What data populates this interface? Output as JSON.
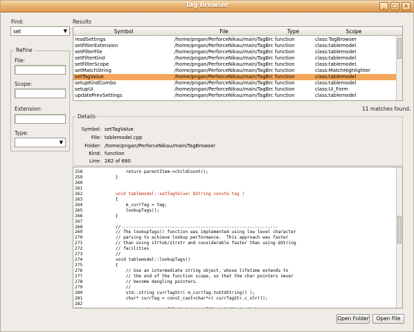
{
  "window": {
    "title": "Tag Browser"
  },
  "left": {
    "find_label": "Find:",
    "find_value": "set",
    "refine_label": "Refine",
    "file_label": "File:",
    "scope_label": "Scope:",
    "extension_label": "Extension:",
    "type_label": "Type:"
  },
  "results": {
    "label": "Results",
    "headers": {
      "symbol": "Symbol",
      "file": "File",
      "type": "Type",
      "scope": "Scope"
    },
    "rows": [
      {
        "symbol": "readSettings",
        "file": "/home/pngan/PerforceNikau/main/TagBrowser",
        "type": "function",
        "scope": "class:TagBrowser"
      },
      {
        "symbol": "setFilterExtension",
        "file": "/home/pngan/PerforceNikau/main/TagBro...",
        "type": "function",
        "scope": "class:tablemodel"
      },
      {
        "symbol": "setFilterFile",
        "file": "/home/pngan/PerforceNikau/main/TagBro...",
        "type": "function",
        "scope": "class:tablemodel"
      },
      {
        "symbol": "setFilterKind",
        "file": "/home/pngan/PerforceNikau/main/TagBro...",
        "type": "function",
        "scope": "class:tablemodel"
      },
      {
        "symbol": "setFilterScope",
        "file": "/home/pngan/PerforceNikau/main/TagBro...",
        "type": "function",
        "scope": "class:tablemodel"
      },
      {
        "symbol": "setMatchString",
        "file": "/home/pngan/PerforceNikau/main/TagBro...",
        "type": "function",
        "scope": "class:MatchHighlighter"
      },
      {
        "symbol": "setTagValue",
        "file": "/home/pngan/PerforceNikau/main/TagBro...",
        "type": "function",
        "scope": "class:tablemodel"
      },
      {
        "symbol": "setupKindCombo",
        "file": "/home/pngan/PerforceNikau/main/TagBro...",
        "type": "function",
        "scope": "class:tablemodel"
      },
      {
        "symbol": "setupUi",
        "file": "/home/pngan/PerforceNikau/main/TagBro...",
        "type": "function",
        "scope": "class:Ui_Form"
      },
      {
        "symbol": "updatePrevSettings",
        "file": "/home/pngan/PerforceNikau/main/TagBro...",
        "type": "function",
        "scope": "class:tablemodel"
      }
    ],
    "selected_index": 6,
    "match_count": "11 matches found."
  },
  "details": {
    "label": "Details",
    "symbol_label": "Symbol:",
    "symbol": "setTagValue",
    "file_label": "File:",
    "file": "tablemodel.cpp",
    "folder_label": "Folder:",
    "folder": "/home/pngan/PerforceNikau/main/TagBrowser",
    "kind_label": "Kind:",
    "kind": "function",
    "line_label": "Line:",
    "line": "262 of 680"
  },
  "code": {
    "lines": [
      {
        "n": "258",
        "t": "        return parentItem->childCount();"
      },
      {
        "n": "259",
        "t": "    }"
      },
      {
        "n": "260",
        "t": ""
      },
      {
        "n": "261",
        "t": ""
      },
      {
        "n": "262",
        "t": "    void tablemodel::setTagValue( QString const& tag )"
      },
      {
        "n": "263",
        "t": "    {"
      },
      {
        "n": "264",
        "t": "        m_currTag = tag;"
      },
      {
        "n": "265",
        "t": "        lookupTags();"
      },
      {
        "n": "266",
        "t": "    }"
      },
      {
        "n": "267",
        "t": ""
      },
      {
        "n": "268",
        "t": "    //-------------------------------------------------------------"
      },
      {
        "n": "269",
        "t": "    // The lookupTags() function was implemented using low level character"
      },
      {
        "n": "270",
        "t": "    // parsing to achieve lookup performance.  This approach was faster"
      },
      {
        "n": "271",
        "t": "    // than using strtok/strstr and considerable faster than using QString"
      },
      {
        "n": "272",
        "t": "    // facilities"
      },
      {
        "n": "273",
        "t": "    //"
      },
      {
        "n": "274",
        "t": "    void tablemodel::lookupTags()"
      },
      {
        "n": "275",
        "t": "    {"
      },
      {
        "n": "276",
        "t": "        // Use an intermediate string object, whose lifetime extends to"
      },
      {
        "n": "277",
        "t": "        // the end of the function scope, so that the char pointers never"
      },
      {
        "n": "278",
        "t": "        // become dangling pointers."
      },
      {
        "n": "279",
        "t": "        //"
      },
      {
        "n": "280",
        "t": "        std::string currTagStr( m_currTag.toStdString() );"
      },
      {
        "n": "281",
        "t": "        char* currTag = const_cast<char*>( currTagStr.c_str());"
      },
      {
        "n": "282",
        "t": ""
      },
      {
        "n": "283",
        "t": "        std::string currFileStr( m_currFile.toStdString() );"
      }
    ],
    "highlight_line_index": 4,
    "highlight_color": "#cc2200"
  },
  "buttons": {
    "open_folder": "Open Folder",
    "open_file": "Open File"
  },
  "colors": {
    "selection": "#f4a65b",
    "titlebar": "#e8b070"
  }
}
